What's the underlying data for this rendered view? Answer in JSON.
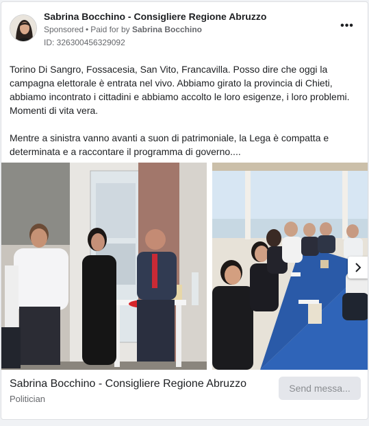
{
  "header": {
    "page_name": "Sabrina Bocchino - Consigliere Regione Abruzzo",
    "sponsored": "Sponsored",
    "separator": "•",
    "paid_for_by": "Paid for by",
    "funder": "Sabrina Bocchino",
    "ad_id": "ID: 326300456329092",
    "more_label": "•••"
  },
  "body": {
    "paragraph1": "Torino Di Sangro, Fossacesia, San Vito, Francavilla. Posso dire che oggi la campagna elettorale è entrata nel vivo. Abbiamo girato la provincia di Chieti, abbiamo incontrato i cittadini e abbiamo accolto le loro esigenze, i loro problemi. Momenti di vita vera.",
    "paragraph2": "Mentre a sinistra vanno avanti a suon di patrimoniale, la Lega è compatta e determinata e a raccontare il programma di governo...."
  },
  "carousel": {
    "slide_count": 2,
    "next_icon": "chevron-right-icon"
  },
  "footer": {
    "page_name": "Sabrina Bocchino - Consigliere Regione Abruzzo",
    "category": "Politician",
    "cta_label": "Send messa..."
  },
  "colors": {
    "text_primary": "#1c1e21",
    "text_secondary": "#65676b",
    "button_bg": "#e4e6eb",
    "button_text": "#8a8d91",
    "card_border": "#dddfe2"
  }
}
